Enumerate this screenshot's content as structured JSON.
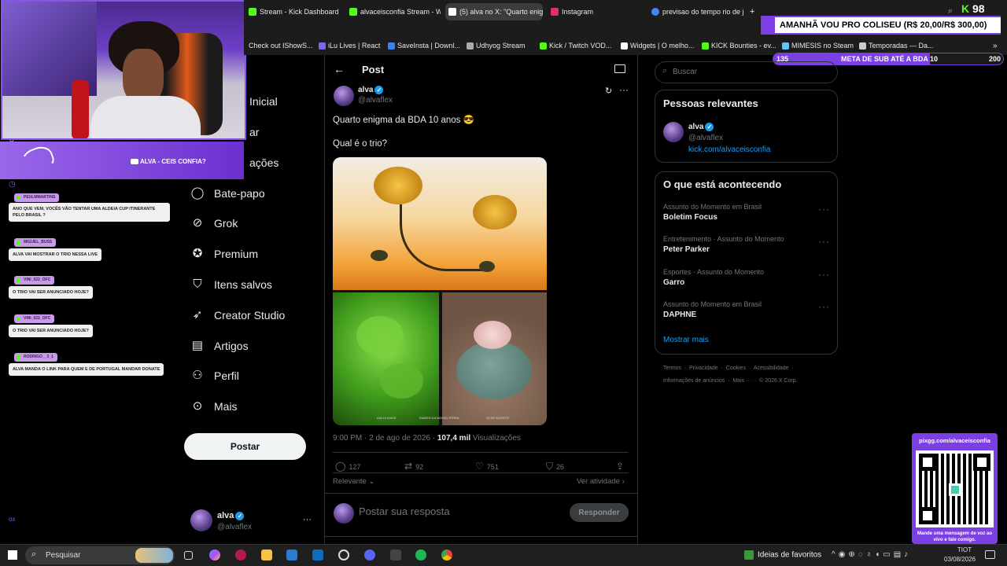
{
  "browser": {
    "tabs": [
      {
        "label": "Stream - Kick Dashboard",
        "color": "#53fc18"
      },
      {
        "label": "alvaceisconfia Stream - W",
        "color": "#53fc18"
      },
      {
        "label": "(5) alva no X: \"Quarto enig",
        "color": "#ffffff",
        "active": true
      },
      {
        "label": "Instagram",
        "color": "#e1306c"
      },
      {
        "label": "previsao do tempo rio de je",
        "color": "#4285f4"
      }
    ],
    "new_tab_label": "+",
    "bookmarks": [
      {
        "label": "Check out IShowS...",
        "color": "#ff0000"
      },
      {
        "label": "iLu Lives | React",
        "color": "#7b68ee"
      },
      {
        "label": "SaveInsta | Downl...",
        "color": "#3b82f6"
      },
      {
        "label": "Udhyog Stream",
        "color": "#aaaaaa"
      },
      {
        "label": "Kick / Twitch VOD...",
        "color": "#53fc18"
      },
      {
        "label": "Widgets | O melho...",
        "color": "#ffffff"
      },
      {
        "label": "KICK Bounties - ev...",
        "color": "#53fc18"
      },
      {
        "label": "MIMESIS no Steam",
        "color": "#66c0f4"
      },
      {
        "label": "Temporadas — Da...",
        "color": "#cccccc"
      }
    ]
  },
  "overlay": {
    "viewer_count": "98",
    "banner_text": "AMANHÃ VOU PRO COLISEU (R$ 20,00/R$ 300,00)",
    "goal_start": "135",
    "goal_text": "META DE SUB ATÉ A BDA 10",
    "goal_end": "200",
    "goal_progress": 0.68,
    "stream_tag": "ALVA - CEIS CONFIA?",
    "qr_url": "pixgg.com/alvaceisconfia",
    "qr_caption": "Mande uma mensagem de voz ao vivo e fale comigo."
  },
  "chat": [
    {
      "user": "PEULMMARTINS",
      "message": "ANO QUE VEM, VOCÊS VÃO TENTAR UMA ALDEIA CUP ITINERANTE PELO BRASIL ?"
    },
    {
      "user": "MIGUEL_BUSS",
      "message": "ALVA VAI MOSTRAR O TRIO NESSA LIVE"
    },
    {
      "user": "VINI_022_OFC",
      "message": "O TRIO VAI SER ANUNCIADO HOJE?"
    },
    {
      "user": "VINI_022_OFC",
      "message": "O TRIO VAI SER ANUNCIADO HOJE?"
    },
    {
      "user": "RODRIGO__3_1",
      "message": "ALVA MANDA O LINK PARA QUEM E DE PORTUGAL MANDAR DONATE"
    }
  ],
  "nav": {
    "items": [
      {
        "label": "Página Inicial",
        "visible": "Inicial",
        "icon": "home-icon",
        "glyph": "⌂"
      },
      {
        "label": "Explorar",
        "visible": "ar",
        "icon": "search-icon",
        "glyph": "⌕"
      },
      {
        "label": "Notificações",
        "visible": "ações",
        "icon": "bell-icon",
        "glyph": "🔔"
      },
      {
        "label": "Bate-papo",
        "visible": "Bate-papo",
        "icon": "chat-icon",
        "glyph": "💬"
      },
      {
        "label": "Grok",
        "visible": "Grok",
        "icon": "grok-icon",
        "glyph": "⊘"
      },
      {
        "label": "Premium",
        "visible": "Premium",
        "icon": "premium-icon",
        "glyph": "✓"
      },
      {
        "label": "Itens salvos",
        "visible": "Itens salvos",
        "icon": "bookmark-icon",
        "glyph": "🔖"
      },
      {
        "label": "Creator Studio",
        "visible": "Creator Studio",
        "icon": "rocket-icon",
        "glyph": "🚀"
      },
      {
        "label": "Artigos",
        "visible": "Artigos",
        "icon": "article-icon",
        "glyph": "▤"
      },
      {
        "label": "Perfil",
        "visible": "Perfil",
        "icon": "profile-icon",
        "glyph": "👤"
      },
      {
        "label": "Mais",
        "visible": "Mais",
        "icon": "more-circle-icon",
        "glyph": "⋯"
      }
    ],
    "post_button": "Postar",
    "account_name": "alva",
    "account_handle": "@alvaflex",
    "account_more": "···"
  },
  "post": {
    "header_title": "Post",
    "back_glyph": "←",
    "reader_glyph": "📖",
    "author_name": "alva",
    "author_handle": "@alvaflex",
    "text_line1": "Quarto enigma da BDA 10 anos 😎",
    "text_line2": "Qual é o trio?",
    "timestamp": "9:00 PM · 2 de ago de 2026 ·",
    "views": "107,4 mil",
    "views_label": "Visualizações",
    "replies": "127",
    "reposts": "92",
    "likes": "751",
    "bookmarks": "26",
    "sort_label": "Relevante",
    "activity_label": "Ver atividade",
    "reply_placeholder": "Postar sua resposta",
    "reply_button": "Responder",
    "image_captions": [
      "DIA 10 ANOS",
      "RAÍZES DA NOSSA TERRA",
      "23 DE AGOSTO"
    ]
  },
  "sidebar": {
    "search_placeholder": "Buscar",
    "relevant_title": "Pessoas relevantes",
    "relevant_name": "alva",
    "relevant_handle": "@alvaflex",
    "relevant_link": "kick.com/alvaceisconfia",
    "trends_title": "O que está acontecendo",
    "trends": [
      {
        "category": "Assunto do Momento em Brasil",
        "name": "Boletim Focus"
      },
      {
        "category": "Entretenimento · Assunto do Momento",
        "name": "Peter Parker"
      },
      {
        "category": "Esportes · Assunto do Momento",
        "name": "Garro"
      },
      {
        "category": "Assunto do Momento em Brasil",
        "name": "DAPHNE"
      }
    ],
    "show_more": "Mostrar mais",
    "footer_line1": [
      "Termos",
      "Privacidade",
      "Cookies",
      "Acessibilidade"
    ],
    "footer_line2": [
      "Informações de anúncios",
      "Mais ···",
      "© 2026 X Corp."
    ]
  },
  "taskbar": {
    "search_placeholder": "Pesquisar",
    "favorites_label": "Ideias de favoritos",
    "time": "TIOT",
    "date": "03/08/2026"
  },
  "colors": {
    "x_blue": "#1d9bf0",
    "kick_green": "#53fc18",
    "overlay_purple": "#7b3fe4"
  }
}
